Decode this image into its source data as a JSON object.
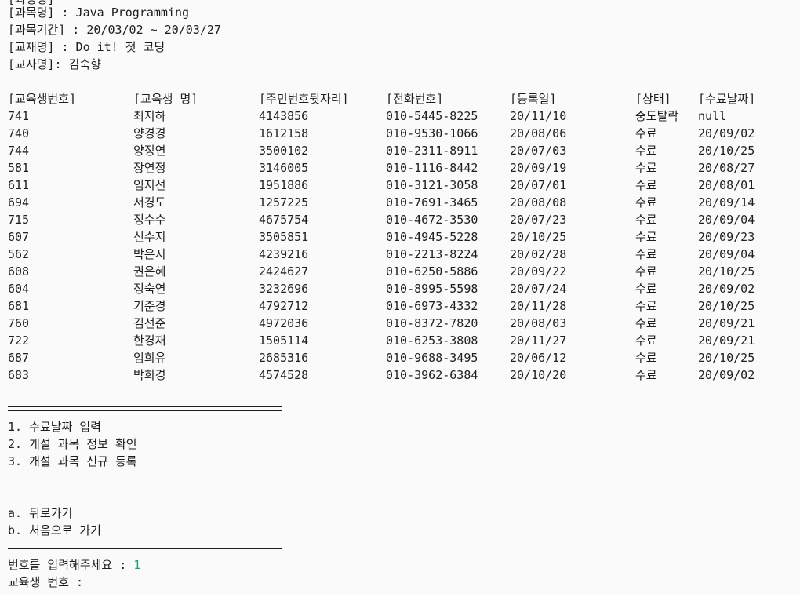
{
  "course_info": {
    "partial_header": "[과정명]",
    "course_name": "[과목명] : Java Programming",
    "course_period": "[과목기간] : 20/03/02 ~ 20/03/27",
    "textbook": "[교재명] : Do it! 첫 코딩",
    "teacher": "[교사명]: 김숙향"
  },
  "table": {
    "columns": [
      "[교육생번호]",
      "[교육생 명]",
      "[주민번호뒷자리]",
      "[전화번호]",
      "[등록일]",
      "[상태]",
      "[수료날짜]"
    ],
    "rows": [
      [
        "741",
        "최지하",
        "4143856",
        "010-5445-8225",
        "20/11/10",
        "중도탈락",
        "null"
      ],
      [
        "740",
        "양경경",
        "1612158",
        "010-9530-1066",
        "20/08/06",
        "수료",
        "20/09/02"
      ],
      [
        "744",
        "양정연",
        "3500102",
        "010-2311-8911",
        "20/07/03",
        "수료",
        "20/10/25"
      ],
      [
        "581",
        "장연정",
        "3146005",
        "010-1116-8442",
        "20/09/19",
        "수료",
        "20/08/27"
      ],
      [
        "611",
        "임지선",
        "1951886",
        "010-3121-3058",
        "20/07/01",
        "수료",
        "20/08/01"
      ],
      [
        "694",
        "서경도",
        "1257225",
        "010-7691-3465",
        "20/08/08",
        "수료",
        "20/09/14"
      ],
      [
        "715",
        "정수수",
        "4675754",
        "010-4672-3530",
        "20/07/23",
        "수료",
        "20/09/04"
      ],
      [
        "607",
        "신수지",
        "3505851",
        "010-4945-5228",
        "20/10/25",
        "수료",
        "20/09/23"
      ],
      [
        "562",
        "박은지",
        "4239216",
        "010-2213-8224",
        "20/02/28",
        "수료",
        "20/09/04"
      ],
      [
        "608",
        "권은혜",
        "2424627",
        "010-6250-5886",
        "20/09/22",
        "수료",
        "20/10/25"
      ],
      [
        "604",
        "정숙연",
        "3232696",
        "010-8995-5598",
        "20/07/24",
        "수료",
        "20/09/02"
      ],
      [
        "681",
        "기준경",
        "4792712",
        "010-6973-4332",
        "20/11/28",
        "수료",
        "20/10/25"
      ],
      [
        "760",
        "김선준",
        "4972036",
        "010-8372-7820",
        "20/08/03",
        "수료",
        "20/09/21"
      ],
      [
        "722",
        "한경재",
        "1505114",
        "010-6253-3808",
        "20/11/27",
        "수료",
        "20/09/21"
      ],
      [
        "687",
        "임희유",
        "2685316",
        "010-9688-3495",
        "20/06/12",
        "수료",
        "20/10/25"
      ],
      [
        "683",
        "박희경",
        "4574528",
        "010-3962-6384",
        "20/10/20",
        "수료",
        "20/09/02"
      ]
    ]
  },
  "menu": {
    "items": [
      "1. 수료날짜 입력",
      "2. 개설 과목 정보 확인",
      "3. 개설 과목 신규 등록"
    ],
    "nav": [
      "a. 뒤로가기",
      "b. 처음으로 가기"
    ]
  },
  "prompt": {
    "number_label": "번호를 입력해주세요 : ",
    "number_value": "1",
    "student_label": "교육생 번호 :"
  },
  "colors": {
    "text": "#1e1e1e",
    "input_value": "#16a36a",
    "background": "#fafafa"
  }
}
